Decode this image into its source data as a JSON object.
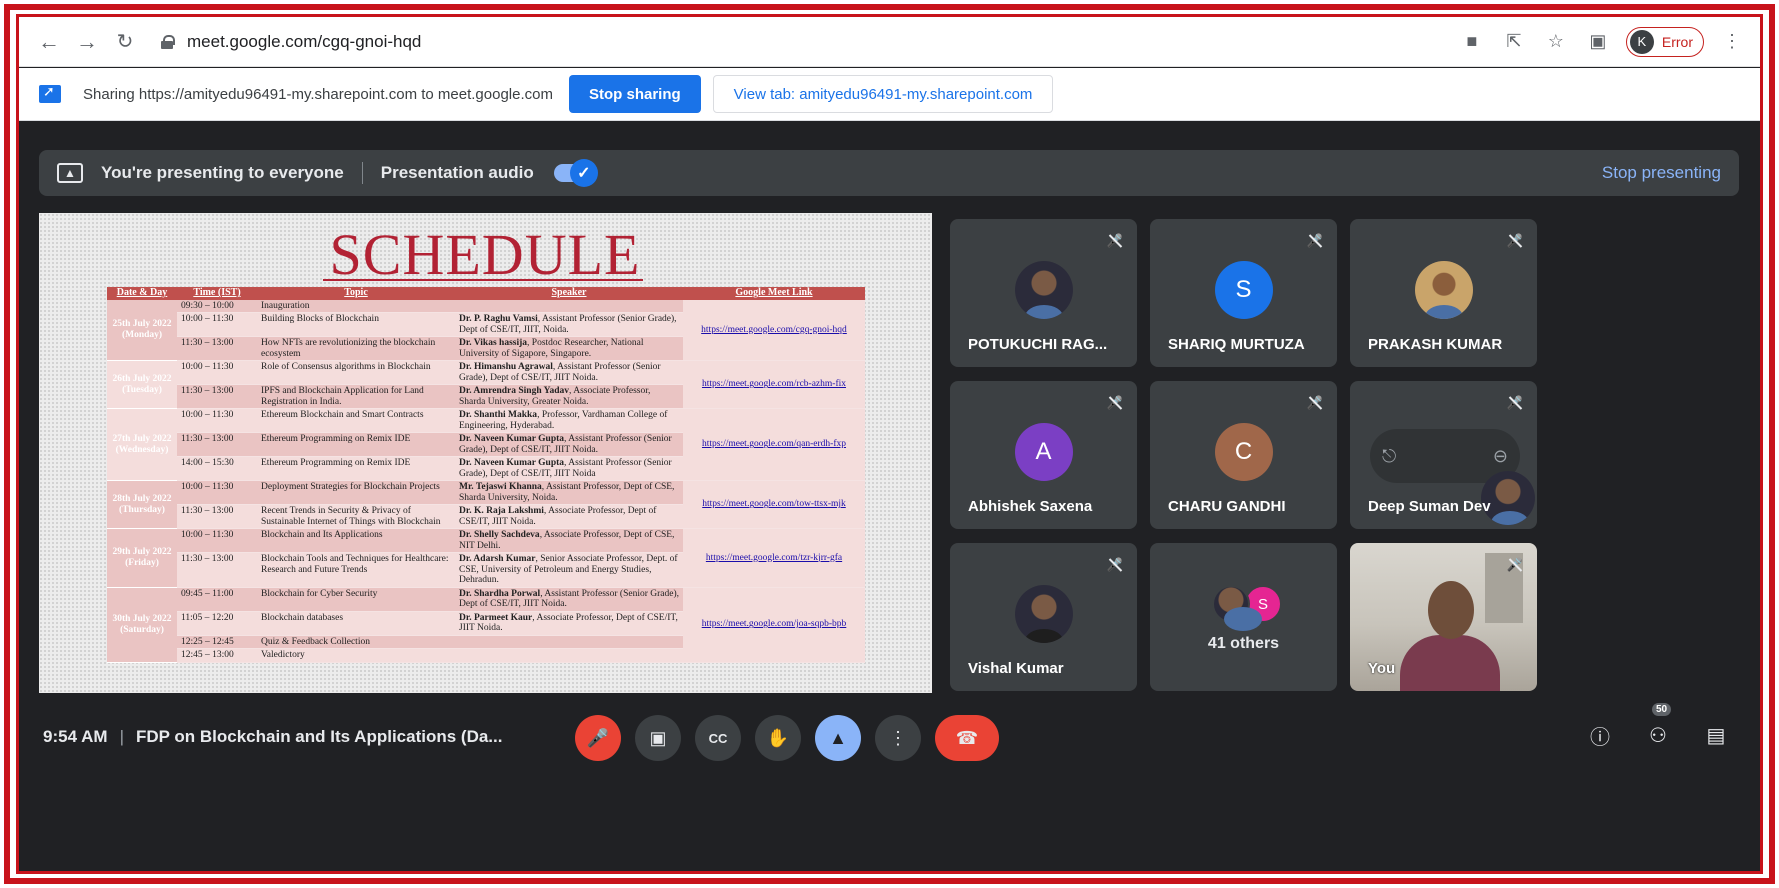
{
  "browser": {
    "url": "meet.google.com/cgq-gnoi-hqd",
    "profile_initial": "K",
    "profile_status": "Error"
  },
  "share_bar": {
    "text": "Sharing https://amityedu96491-my.sharepoint.com to meet.google.com",
    "stop_label": "Stop sharing",
    "view_tab_label": "View tab: amityedu96491-my.sharepoint.com"
  },
  "present_bar": {
    "presenting_text": "You're presenting to everyone",
    "audio_label": "Presentation audio",
    "stop_label": "Stop presenting"
  },
  "slide": {
    "title": "SCHEDULE",
    "headers": [
      "Date & Day",
      "Time (IST)",
      "Topic",
      "Speaker",
      "Google Meet Link"
    ],
    "days": [
      {
        "date": "25th July 2022",
        "weekday": "(Monday)",
        "link": "https://meet.google.com/cgq-gnoi-hqd",
        "rows": [
          {
            "time": "09:30 – 10:00",
            "topic": "Inauguration",
            "speaker_name": "",
            "speaker_rest": ""
          },
          {
            "time": "10:00 – 11:30",
            "topic": "Building Blocks of Blockchain",
            "speaker_name": "Dr. P. Raghu Vamsi",
            "speaker_rest": ", Assistant Professor (Senior Grade), Dept of CSE/IT, JIIT, Noida."
          },
          {
            "time": "11:30 – 13:00",
            "topic": "How NFTs are revolutionizing the blockchain ecosystem",
            "speaker_name": "Dr. Vikas hassija",
            "speaker_rest": ", Postdoc Researcher, National University of Sigapore, Singapore."
          }
        ]
      },
      {
        "date": "26th July 2022",
        "weekday": "(Tuesday)",
        "link": "https://meet.google.com/rcb-azhm-fix",
        "rows": [
          {
            "time": "10:00 – 11:30",
            "topic": "Role of Consensus algorithms in Blockchain",
            "speaker_name": "Dr. Himanshu Agrawal",
            "speaker_rest": ", Assistant Professor (Senior Grade), Dept of CSE/IT, JIIT Noida."
          },
          {
            "time": "11:30 – 13:00",
            "topic": "IPFS and Blockchain Application for Land Registration in India.",
            "speaker_name": "Dr. Amrendra Singh Yadav",
            "speaker_rest": ", Associate Professor, Sharda University, Greater Noida."
          }
        ]
      },
      {
        "date": "27th July 2022",
        "weekday": "(Wednesday)",
        "link": "https://meet.google.com/qan-erdh-fxp",
        "rows": [
          {
            "time": "10:00 – 11:30",
            "topic": "Ethereum Blockchain and Smart Contracts",
            "speaker_name": "Dr. Shanthi Makka",
            "speaker_rest": ", Professor, Vardhaman College of Engineering, Hyderabad."
          },
          {
            "time": "11:30 – 13:00",
            "topic": "Ethereum Programming on Remix IDE",
            "speaker_name": "Dr. Naveen Kumar Gupta",
            "speaker_rest": ", Assistant Professor (Senior Grade), Dept of CSE/IT, JIIT Noida."
          },
          {
            "time": "14:00 – 15:30",
            "topic": "Ethereum Programming on Remix IDE",
            "speaker_name": "Dr. Naveen Kumar Gupta",
            "speaker_rest": ", Assistant Professor (Senior Grade), Dept of CSE/IT, JIIT Noida"
          }
        ]
      },
      {
        "date": "28th July 2022",
        "weekday": "(Thursday)",
        "link": "https://meet.google.com/tow-ttsx-mjk",
        "rows": [
          {
            "time": "10:00 – 11:30",
            "topic": "Deployment Strategies for Blockchain Projects",
            "speaker_name": "Mr. Tejaswi Khanna",
            "speaker_rest": ", Assistant Professor, Dept of CSE, Sharda University, Noida."
          },
          {
            "time": "11:30 – 13:00",
            "topic": "Recent Trends in Security & Privacy of Sustainable Internet of Things with Blockchain",
            "speaker_name": "Dr. K. Raja Lakshmi",
            "speaker_rest": ", Associate Professor, Dept of CSE/IT, JIIT Noida."
          }
        ]
      },
      {
        "date": "29th July 2022",
        "weekday": "(Friday)",
        "link": "https://meet.google.com/tzr-kjrr-gfa",
        "rows": [
          {
            "time": "10:00 – 11:30",
            "topic": "Blockchain and Its Applications",
            "speaker_name": "Dr. Shelly Sachdeva",
            "speaker_rest": ", Associate Professor, Dept of CSE, NIT Delhi."
          },
          {
            "time": "11:30 – 13:00",
            "topic": "Blockchain Tools and Techniques for Healthcare: Research and Future Trends",
            "speaker_name": "Dr. Adarsh Kumar",
            "speaker_rest": ", Senior Associate Professor, Dept. of CSE, University of Petroleum and Energy Studies, Dehradun."
          }
        ]
      },
      {
        "date": "30th July 2022",
        "weekday": "(Saturday)",
        "link": "https://meet.google.com/joa-sqpb-bpb",
        "rows": [
          {
            "time": "09:45 – 11:00",
            "topic": "Blockchain for Cyber Security",
            "speaker_name": "Dr. Shardha Porwal",
            "speaker_rest": ", Assistant Professor (Senior Grade), Dept of CSE/IT, JIIT Noida."
          },
          {
            "time": "11:05 – 12:20",
            "topic": "Blockchain databases",
            "speaker_name": "Dr. Parmeet Kaur",
            "speaker_rest": ", Associate Professor, Dept of CSE/IT, JIIT Noida."
          },
          {
            "time": "12:25 – 12:45",
            "topic": "Quiz & Feedback Collection",
            "speaker_name": "",
            "speaker_rest": ""
          },
          {
            "time": "12:45 – 13:00",
            "topic": "Valedictory",
            "speaker_name": "",
            "speaker_rest": ""
          }
        ]
      }
    ]
  },
  "participants": [
    {
      "name": "POTUKUCHI RAG...",
      "avatar_type": "photo",
      "initial": ""
    },
    {
      "name": "SHARIQ MURTUZA",
      "avatar_type": "letter",
      "initial": "S",
      "color": "#1a73e8"
    },
    {
      "name": "PRAKASH KUMAR",
      "avatar_type": "photo",
      "initial": ""
    },
    {
      "name": "Abhishek Saxena",
      "avatar_type": "letter",
      "initial": "A",
      "color": "#7b3fc4"
    },
    {
      "name": "CHARU GANDHI",
      "avatar_type": "letter",
      "initial": "C",
      "color": "#a0674a"
    },
    {
      "name": "Deep Suman Dev",
      "avatar_type": "photo",
      "initial": ""
    },
    {
      "name": "Vishal Kumar",
      "avatar_type": "photo",
      "initial": ""
    },
    {
      "name": "41 others",
      "avatar_type": "group",
      "initial": "S",
      "color": "#e52592"
    },
    {
      "name": "You",
      "avatar_type": "video",
      "initial": ""
    }
  ],
  "meeting": {
    "time": "9:54 AM",
    "separator": "|",
    "title": "FDP on Blockchain and Its Applications (Da...",
    "participant_count": "50"
  },
  "icons": {
    "mic_off": "mic-off-icon",
    "camera": "camera-icon",
    "captions": "captions-icon",
    "raise_hand": "hand-icon",
    "present": "present-icon",
    "more": "more-icon",
    "hangup": "hangup-icon",
    "info": "info-icon",
    "people": "people-icon",
    "chat": "chat-icon"
  }
}
